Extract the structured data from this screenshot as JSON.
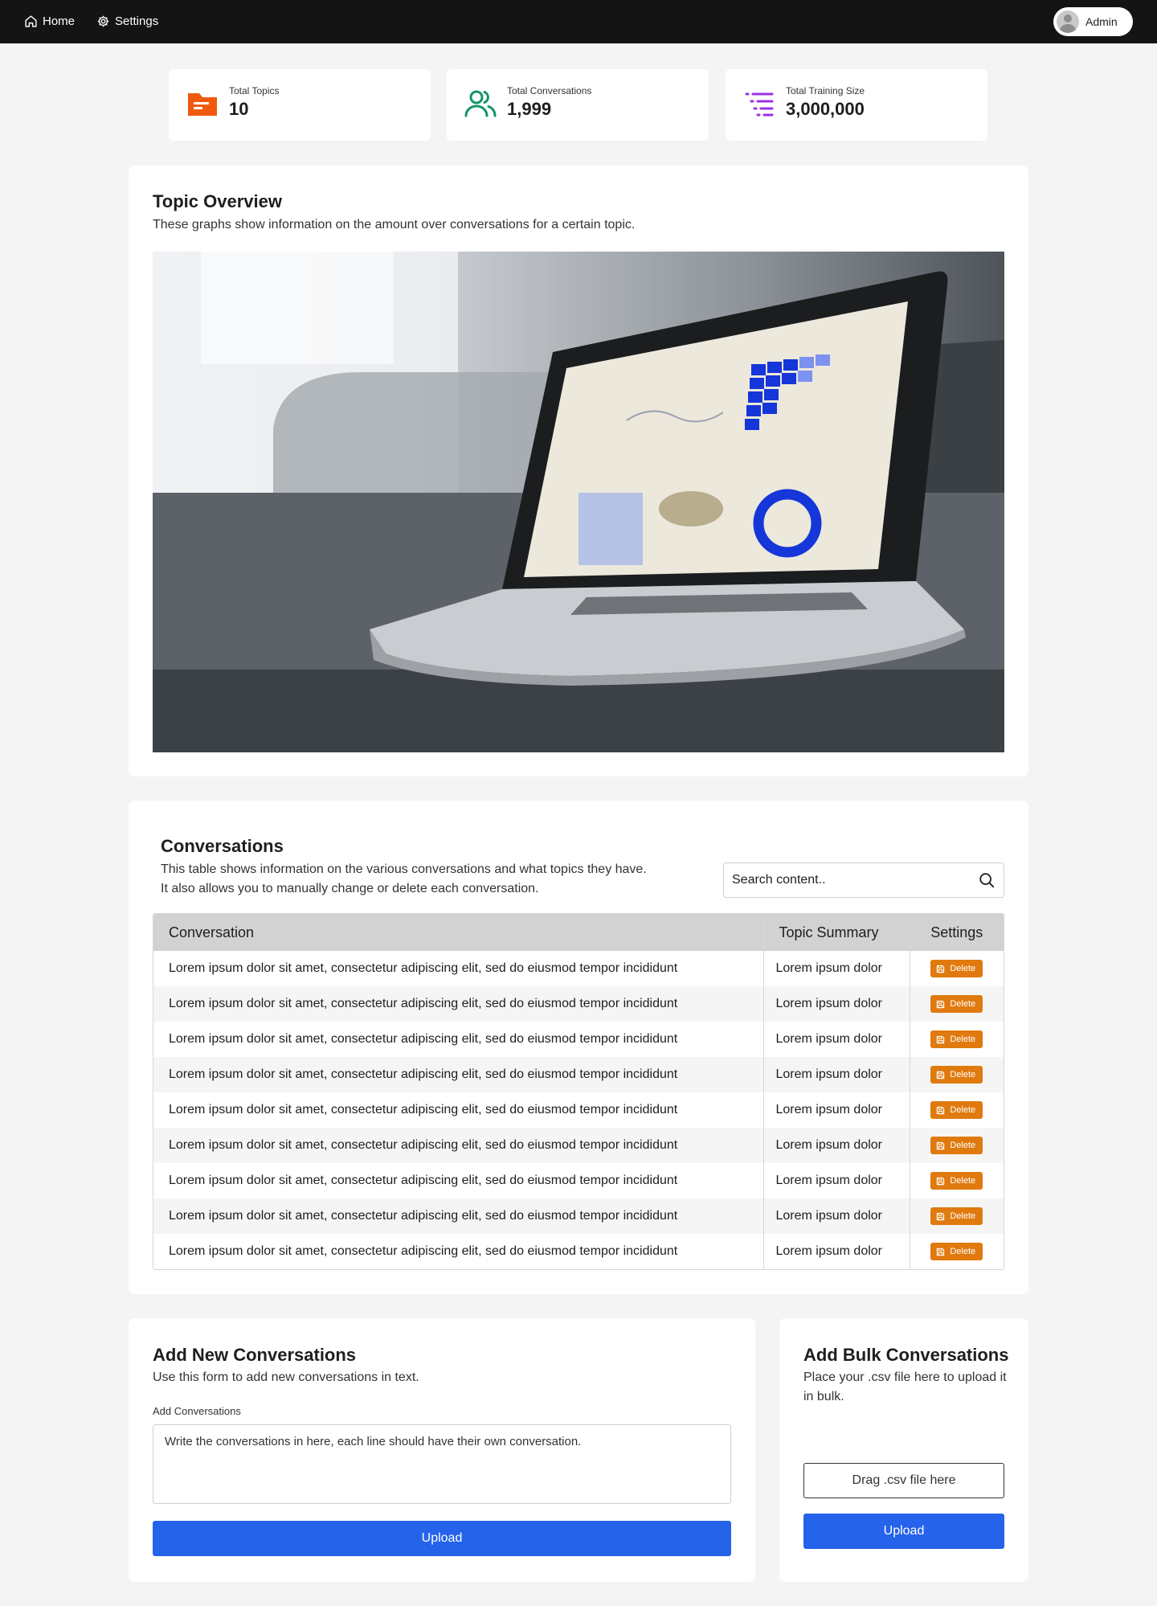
{
  "nav": {
    "home_label": "Home",
    "settings_label": "Settings",
    "user_label": "Admin"
  },
  "stats": [
    {
      "label": "Total Topics",
      "value": "10",
      "icon": "folder-icon",
      "color": "#f05a0f"
    },
    {
      "label": "Total Conversations",
      "value": "1,999",
      "icon": "users-icon",
      "color": "#11946b"
    },
    {
      "label": "Total Training Size",
      "value": "3,000,000",
      "icon": "list-icon",
      "color": "#9b30e6"
    }
  ],
  "overview": {
    "title": "Topic Overview",
    "description": "These graphs show information on the amount over conversations for a certain topic."
  },
  "conversations": {
    "title": "Conversations",
    "description_line1": "This table shows information on the various conversations and what topics they have.",
    "description_line2": "It also allows you to manually change or delete each conversation.",
    "search_placeholder": "Search content..",
    "columns": [
      "Conversation",
      "Topic Summary",
      "Settings"
    ],
    "delete_label": "Delete",
    "rows": [
      {
        "conversation": "Lorem ipsum dolor sit amet, consectetur adipiscing elit, sed do eiusmod tempor incididunt",
        "topic": "Lorem ipsum dolor"
      },
      {
        "conversation": "Lorem ipsum dolor sit amet, consectetur adipiscing elit, sed do eiusmod tempor incididunt",
        "topic": "Lorem ipsum dolor"
      },
      {
        "conversation": "Lorem ipsum dolor sit amet, consectetur adipiscing elit, sed do eiusmod tempor incididunt",
        "topic": "Lorem ipsum dolor"
      },
      {
        "conversation": "Lorem ipsum dolor sit amet, consectetur adipiscing elit, sed do eiusmod tempor incididunt",
        "topic": "Lorem ipsum dolor"
      },
      {
        "conversation": "Lorem ipsum dolor sit amet, consectetur adipiscing elit, sed do eiusmod tempor incididunt",
        "topic": "Lorem ipsum dolor"
      },
      {
        "conversation": "Lorem ipsum dolor sit amet, consectetur adipiscing elit, sed do eiusmod tempor incididunt",
        "topic": "Lorem ipsum dolor"
      },
      {
        "conversation": "Lorem ipsum dolor sit amet, consectetur adipiscing elit, sed do eiusmod tempor incididunt",
        "topic": "Lorem ipsum dolor"
      },
      {
        "conversation": "Lorem ipsum dolor sit amet, consectetur adipiscing elit, sed do eiusmod tempor incididunt",
        "topic": "Lorem ipsum dolor"
      },
      {
        "conversation": "Lorem ipsum dolor sit amet, consectetur adipiscing elit, sed do eiusmod tempor incididunt",
        "topic": "Lorem ipsum dolor"
      }
    ]
  },
  "add_new": {
    "title": "Add New Conversations",
    "description": "Use this form to add new conversations in text.",
    "field_label": "Add Conversations",
    "textarea_placeholder": "Write the conversations in here, each line should have their own conversation.",
    "upload_label": "Upload"
  },
  "add_bulk": {
    "title": "Add Bulk Conversations",
    "description": "Place your .csv file here to upload it in bulk.",
    "drop_label": "Drag .csv file here",
    "upload_label": "Upload"
  },
  "colors": {
    "accent_blue": "#2563eb",
    "delete_orange": "#e07a0f",
    "nav_bg": "#141414",
    "page_bg": "#f4f4f4"
  }
}
